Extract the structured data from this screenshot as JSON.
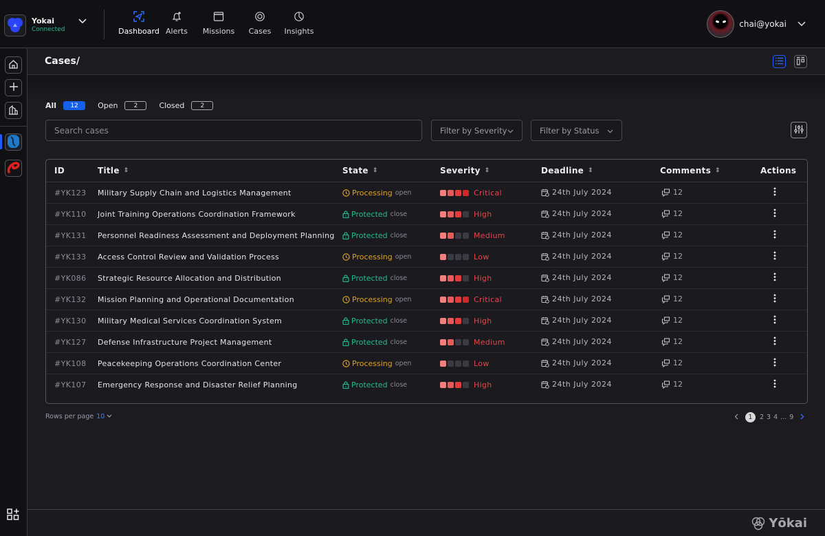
{
  "brand": {
    "name": "Yokai",
    "status": "Connected"
  },
  "nav": [
    {
      "label": "Dashboard",
      "icon": "dashboard-icon",
      "active": true
    },
    {
      "label": "Alerts",
      "icon": "bell-icon"
    },
    {
      "label": "Missions",
      "icon": "window-icon"
    },
    {
      "label": "Cases",
      "icon": "target-icon"
    },
    {
      "label": "Insights",
      "icon": "pie-chart-icon"
    }
  ],
  "user": {
    "name": "chai@yokai"
  },
  "page": {
    "title": "Cases/"
  },
  "tabs": [
    {
      "label": "All",
      "count": "12",
      "active": true
    },
    {
      "label": "Open",
      "count": "2"
    },
    {
      "label": "Closed",
      "count": "2"
    }
  ],
  "search": {
    "placeholder": "Search cases",
    "value": ""
  },
  "filters": {
    "severity": "Filter by Severity",
    "status": "Filter by Status"
  },
  "table": {
    "columns": {
      "id": "ID",
      "title": "Title",
      "state": "State",
      "severity": "Severity",
      "deadline": "Deadline",
      "comments": "Comments",
      "actions": "Actions"
    },
    "rows": [
      {
        "id": "#YK123",
        "title": "Military Supply Chain and Logistics Management",
        "state": "Processing",
        "state_sub": "open",
        "severity": "Critical",
        "level": 4,
        "deadline": "24th July 2024",
        "comments": "12"
      },
      {
        "id": "#YK110",
        "title": "Joint Training Operations Coordination Framework",
        "state": "Protected",
        "state_sub": "close",
        "severity": "High",
        "level": 3,
        "deadline": "24th July 2024",
        "comments": "12"
      },
      {
        "id": "#YK131",
        "title": "Personnel Readiness Assessment and Deployment Planning",
        "state": "Protected",
        "state_sub": "close",
        "severity": "Medium",
        "level": 2,
        "deadline": "24th July 2024",
        "comments": "12"
      },
      {
        "id": "#YK133",
        "title": "Access Control Review and Validation Process",
        "state": "Processing",
        "state_sub": "open",
        "severity": "Low",
        "level": 1,
        "deadline": "24th July 2024",
        "comments": "12"
      },
      {
        "id": "#YK086",
        "title": "Strategic Resource Allocation and Distribution",
        "state": "Protected",
        "state_sub": "close",
        "severity": "High",
        "level": 3,
        "deadline": "24th July 2024",
        "comments": "12"
      },
      {
        "id": "#YK132",
        "title": "Mission Planning and Operational Documentation",
        "state": "Processing",
        "state_sub": "open",
        "severity": "Critical",
        "level": 4,
        "deadline": "24th July 2024",
        "comments": "12"
      },
      {
        "id": "#YK130",
        "title": "Military Medical Services Coordination System",
        "state": "Protected",
        "state_sub": "close",
        "severity": "High",
        "level": 3,
        "deadline": "24th July 2024",
        "comments": "12"
      },
      {
        "id": "#YK127",
        "title": "Defense Infrastructure Project Management",
        "state": "Protected",
        "state_sub": "close",
        "severity": "Medium",
        "level": 2,
        "deadline": "24th July 2024",
        "comments": "12"
      },
      {
        "id": "#YK108",
        "title": "Peacekeeping Operations Coordination Center",
        "state": "Processing",
        "state_sub": "open",
        "severity": "Low",
        "level": 1,
        "deadline": "24th July 2024",
        "comments": "12"
      },
      {
        "id": "#YK107",
        "title": "Emergency Response and Disaster Relief Planning",
        "state": "Protected",
        "state_sub": "close",
        "severity": "High",
        "level": 3,
        "deadline": "24th July 2024",
        "comments": "12"
      }
    ]
  },
  "pagination": {
    "rows_per_page_label": "Rows per page",
    "rows_per_page": "10",
    "pages": [
      "1",
      "2",
      "3",
      "4",
      "...",
      "9"
    ],
    "current": "1"
  },
  "footer": {
    "brand": "Yōkai"
  },
  "colors": {
    "accent": "#1560e8",
    "processing": "#e0a020",
    "protected": "#26b88f",
    "severity": "#e04848"
  }
}
